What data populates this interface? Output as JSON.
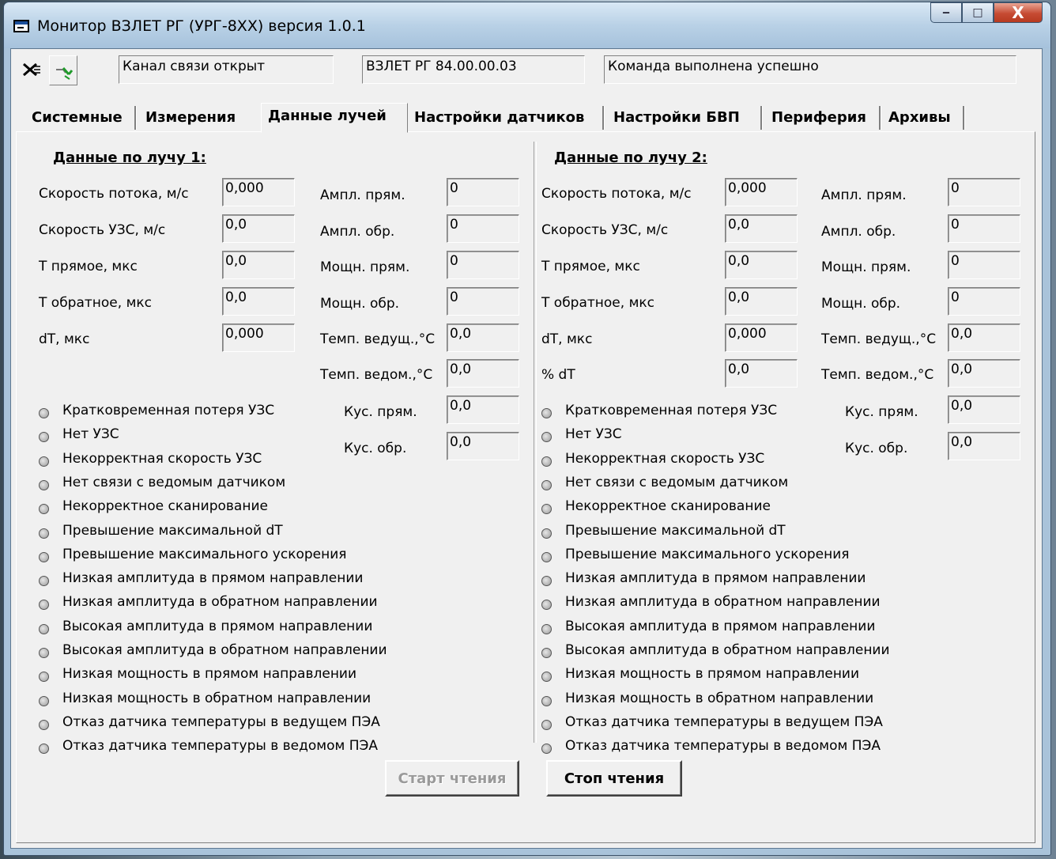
{
  "window": {
    "title": "Монитор ВЗЛЕТ РГ (УРГ-8ХХ) версия 1.0.1",
    "min_label": "‒",
    "max_label": "□",
    "close_label": "X"
  },
  "status": {
    "channel": "Канал связи открыт",
    "device": "ВЗЛЕТ РГ 84.00.00.03",
    "result": "Команда выполнена успешно"
  },
  "tabs": [
    "Системные",
    "Измерения",
    "Данные лучей",
    "Настройки датчиков",
    "Настройки БВП",
    "Периферия",
    "Архивы"
  ],
  "beam1": {
    "heading": "Данные по лучу 1:",
    "left": [
      {
        "label": "Скорость потока, м/с",
        "value": "0,000"
      },
      {
        "label": "Скорость УЗС, м/с",
        "value": "0,0"
      },
      {
        "label": "Т прямое, мкс",
        "value": "0,0"
      },
      {
        "label": "Т обратное, мкс",
        "value": "0,0"
      },
      {
        "label": "dT, мкс",
        "value": "0,000"
      }
    ],
    "right": [
      {
        "label": "Ампл. прям.",
        "value": "0"
      },
      {
        "label": "Ампл. обр.",
        "value": "0"
      },
      {
        "label": "Мощн. прям.",
        "value": "0"
      },
      {
        "label": "Мощн. обр.",
        "value": "0"
      },
      {
        "label": "Темп. ведущ.,°С",
        "value": "0,0"
      },
      {
        "label": "Темп. ведом.,°С",
        "value": "0,0"
      }
    ],
    "kus": [
      {
        "label": "Кус. прям.",
        "value": "0,0"
      },
      {
        "label": "Кус. обр.",
        "value": "0,0"
      }
    ]
  },
  "beam2": {
    "heading": "Данные по лучу 2:",
    "left": [
      {
        "label": "Скорость потока, м/с",
        "value": "0,000"
      },
      {
        "label": "Скорость УЗС, м/с",
        "value": "0,0"
      },
      {
        "label": "Т прямое, мкс",
        "value": "0,0"
      },
      {
        "label": "Т обратное, мкс",
        "value": "0,0"
      },
      {
        "label": "dT, мкс",
        "value": "0,000"
      },
      {
        "label": "% dT",
        "value": "0,0"
      }
    ],
    "right": [
      {
        "label": "Ампл. прям.",
        "value": "0"
      },
      {
        "label": "Ампл. обр.",
        "value": "0"
      },
      {
        "label": "Мощн. прям.",
        "value": "0"
      },
      {
        "label": "Мощн. обр.",
        "value": "0"
      },
      {
        "label": "Темп. ведущ.,°С",
        "value": "0,0"
      },
      {
        "label": "Темп. ведом.,°С",
        "value": "0,0"
      }
    ],
    "kus": [
      {
        "label": "Кус. прям.",
        "value": "0,0"
      },
      {
        "label": "Кус. обр.",
        "value": "0,0"
      }
    ]
  },
  "flags": [
    "Кратковременная потеря УЗС",
    "Нет УЗС",
    "Некорректная скорость УЗС",
    "Нет связи с ведомым датчиком",
    "Некорректное сканирование",
    "Превышение максимальной dT",
    "Превышение максимального ускорения",
    "Низкая амплитуда в прямом направлении",
    "Низкая амплитуда в обратном направлении",
    "Высокая амплитуда в прямом направлении",
    "Высокая амплитуда в обратном направлении",
    "Низкая мощность в прямом направлении",
    "Низкая мощность в обратном направлении",
    "Отказ датчика температуры в ведущем ПЭА",
    "Отказ датчика температуры в ведомом ПЭА"
  ],
  "buttons": {
    "start": "Старт чтения",
    "stop": "Стоп чтения"
  }
}
